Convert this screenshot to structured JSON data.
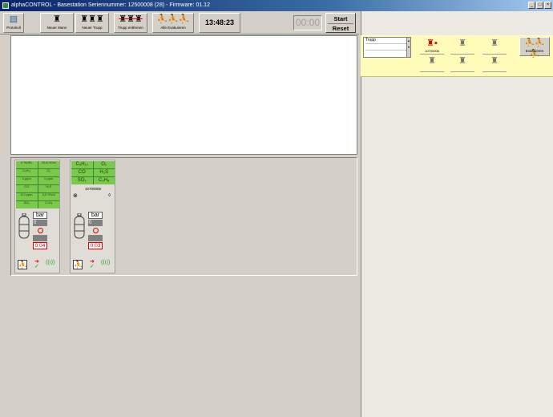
{
  "window": {
    "title": "alphaCONTROL  -  Basestation Seriennummer: 12500008 (28) - Firmware: 01.12",
    "buttons": {
      "minimize": "_",
      "maximize": "□",
      "close": "×"
    }
  },
  "toolbar": {
    "protokoll_label": "Protokoll",
    "neuer_mann_label": "Neuer Mann",
    "neuer_trupp_label": "Neuer Trupp",
    "trupp_entfernen_label": "Trupp entfernen",
    "alle_evakuieren_label": "Alle Evakuieren",
    "clock": "13:48:23",
    "timer": "00:00",
    "start_label": "Start",
    "reset_label": "Reset"
  },
  "trupp_panel": {
    "trupp_label": "Trupp",
    "slot_active_id": "10700006",
    "evakuieren_label": "Evakuieren"
  },
  "cards": [
    {
      "gas": [
        "0 %UEL",
        "20,8 %Vol",
        "C₃H₁₂",
        "O₂",
        "0 ppm",
        "0 ppm",
        "CO",
        "H₂S",
        "0,0 ppm",
        "0,0 %Vol",
        "SO₂",
        "C₃H₈"
      ],
      "bar_label": "bar",
      "bar_value": "0",
      "time": "0:04"
    },
    {
      "gas": [
        "C₅H₁₂",
        "O₂",
        "CO",
        "H₂S",
        "SO₂",
        "C₃H₈"
      ],
      "id": "10700006",
      "bar_label": "bar",
      "bar_value": "0",
      "time": "0:03"
    }
  ]
}
